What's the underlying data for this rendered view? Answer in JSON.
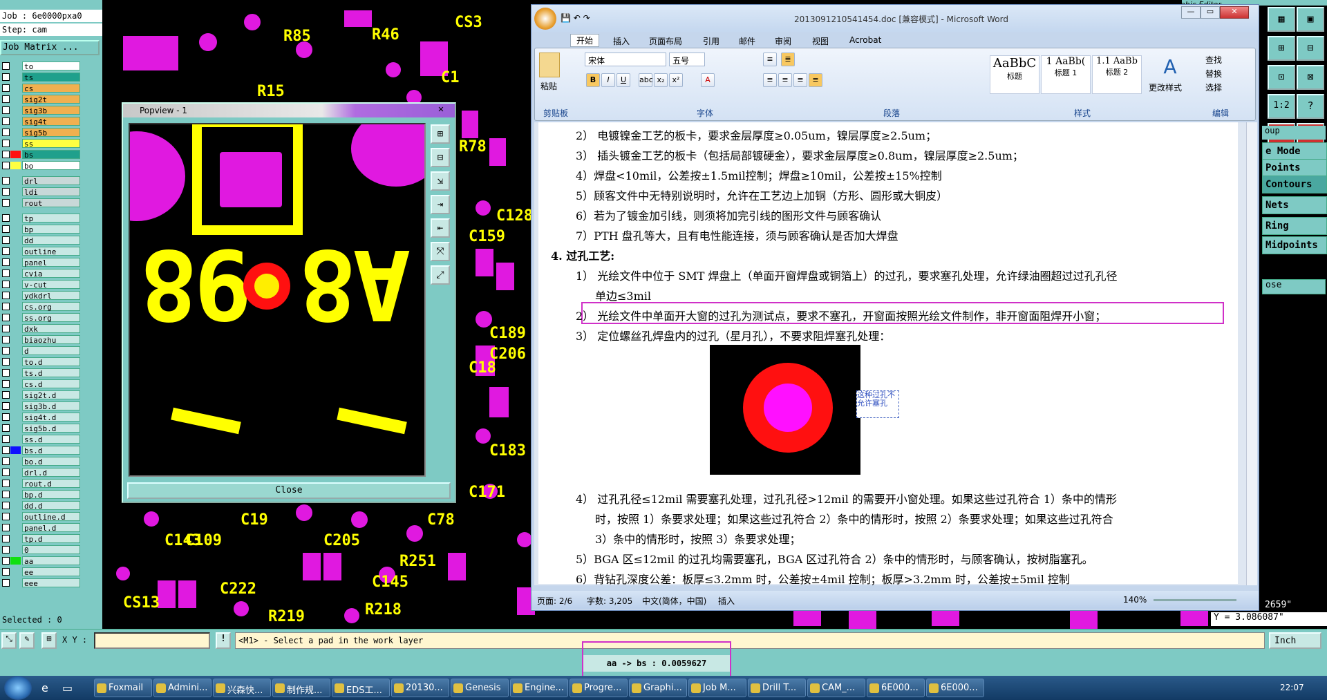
{
  "genesis": {
    "job_label": "Job : 6e0000pxa0",
    "step_label": "Step: cam",
    "job_matrix": "Job Matrix ...",
    "selected": "Selected : 0",
    "layers": [
      {
        "name": "to",
        "swatch": "",
        "bg": "#ffffff"
      },
      {
        "name": "ts",
        "swatch": "",
        "bg": "#1fa08c"
      },
      {
        "name": "cs",
        "swatch": "",
        "bg": "#f0b050"
      },
      {
        "name": "sig2t",
        "swatch": "",
        "bg": "#f0b050"
      },
      {
        "name": "sig3b",
        "swatch": "",
        "bg": "#f0b050"
      },
      {
        "name": "sig4t",
        "swatch": "",
        "bg": "#f0b050"
      },
      {
        "name": "sig5b",
        "swatch": "",
        "bg": "#f0b050"
      },
      {
        "name": "ss",
        "swatch": "",
        "bg": "#ffff40"
      },
      {
        "name": "bs",
        "swatch": "#ff1010",
        "bg": "#1fa08c"
      },
      {
        "name": "bo",
        "swatch": "#ffff40",
        "bg": "#ffffff"
      },
      {
        "name": "drl",
        "swatch": "",
        "bg": "#c8d8d8"
      },
      {
        "name": "ldi",
        "swatch": "",
        "bg": "#c8d8d8"
      },
      {
        "name": "rout",
        "swatch": "",
        "bg": "#c8d8d8"
      },
      {
        "name": "tp",
        "swatch": "",
        "bg": "#c8e8e4"
      },
      {
        "name": "bp",
        "swatch": "",
        "bg": "#c8e8e4"
      },
      {
        "name": "dd",
        "swatch": "",
        "bg": "#c8e8e4"
      },
      {
        "name": "outline",
        "swatch": "",
        "bg": "#c8e8e4"
      },
      {
        "name": "panel",
        "swatch": "",
        "bg": "#c8e8e4"
      },
      {
        "name": "cvia",
        "swatch": "",
        "bg": "#c8e8e4"
      },
      {
        "name": "v-cut",
        "swatch": "",
        "bg": "#c8e8e4"
      },
      {
        "name": "ydkdrl",
        "swatch": "",
        "bg": "#c8e8e4"
      },
      {
        "name": "cs.org",
        "swatch": "",
        "bg": "#c8e8e4"
      },
      {
        "name": "ss.org",
        "swatch": "",
        "bg": "#c8e8e4"
      },
      {
        "name": "dxk",
        "swatch": "",
        "bg": "#c8e8e4"
      },
      {
        "name": "biaozhu",
        "swatch": "",
        "bg": "#c8e8e4"
      },
      {
        "name": "d",
        "swatch": "",
        "bg": "#c8e8e4"
      },
      {
        "name": "to.d",
        "swatch": "",
        "bg": "#c8e8e4"
      },
      {
        "name": "ts.d",
        "swatch": "",
        "bg": "#c8e8e4"
      },
      {
        "name": "cs.d",
        "swatch": "",
        "bg": "#c8e8e4"
      },
      {
        "name": "sig2t.d",
        "swatch": "",
        "bg": "#c8e8e4"
      },
      {
        "name": "sig3b.d",
        "swatch": "",
        "bg": "#c8e8e4"
      },
      {
        "name": "sig4t.d",
        "swatch": "",
        "bg": "#c8e8e4"
      },
      {
        "name": "sig5b.d",
        "swatch": "",
        "bg": "#c8e8e4"
      },
      {
        "name": "ss.d",
        "swatch": "",
        "bg": "#c8e8e4"
      },
      {
        "name": "bs.d",
        "swatch": "#1010ff",
        "bg": "#c8e8e4"
      },
      {
        "name": "bo.d",
        "swatch": "",
        "bg": "#c8e8e4"
      },
      {
        "name": "drl.d",
        "swatch": "",
        "bg": "#c8e8e4"
      },
      {
        "name": "rout.d",
        "swatch": "",
        "bg": "#c8e8e4"
      },
      {
        "name": "bp.d",
        "swatch": "",
        "bg": "#c8e8e4"
      },
      {
        "name": "dd.d",
        "swatch": "",
        "bg": "#c8e8e4"
      },
      {
        "name": "outline.d",
        "swatch": "",
        "bg": "#c8e8e4"
      },
      {
        "name": "panel.d",
        "swatch": "",
        "bg": "#c8e8e4"
      },
      {
        "name": "tp.d",
        "swatch": "",
        "bg": "#c8e8e4"
      },
      {
        "name": "0",
        "swatch": "",
        "bg": "#c8e8e4"
      },
      {
        "name": "aa",
        "swatch": "#10e010",
        "bg": "#c8e8e4"
      },
      {
        "name": "ee",
        "swatch": "",
        "bg": "#c8e8e4"
      },
      {
        "name": "eee",
        "swatch": "",
        "bg": "#c8e8e4"
      }
    ],
    "board_labels": [
      "R85",
      "R46",
      "CS3",
      "C1",
      "R15",
      "R78",
      "R218",
      "C222",
      "C19",
      "C143",
      "C109",
      "C78",
      "C205",
      "R251",
      "C171",
      "C183",
      "CS13",
      "C145",
      "C189",
      "C206",
      "C18",
      "C128",
      "C159",
      "R219"
    ],
    "xy_label": "X Y :",
    "prompt": "<M1> - Select a pad in the work layer",
    "measure": "aa -> bs : 0.0059627",
    "units": "Inch",
    "coord_x_partial": "2659\"",
    "coord_y": "Y = 3.086087\"",
    "graphic_editor_title": "Graphic Editor",
    "right_menu": [
      "e Mode",
      "Points",
      "Contours",
      "Nets",
      "Ring",
      "Midpoints"
    ],
    "close_partial": "ose",
    "group_partial": "oup"
  },
  "popview": {
    "title": "Popview - 1",
    "close": "Close",
    "pad_text_left": "98",
    "pad_text_right": "A8"
  },
  "word": {
    "title": "2013091210541454.doc [兼容模式] - Microsoft Word",
    "tabs": [
      "开始",
      "插入",
      "页面布局",
      "引用",
      "邮件",
      "审阅",
      "视图",
      "Acrobat"
    ],
    "font_name": "宋体",
    "font_size": "五号",
    "paste": "粘贴",
    "groups": [
      "剪贴板",
      "字体",
      "段落",
      "样式",
      "编辑"
    ],
    "styles": [
      {
        "preview": "AaBbC",
        "label": "标题"
      },
      {
        "preview": "1 AaBb(",
        "label": "标题 1"
      },
      {
        "preview": "1.1 AaBb",
        "label": "标题 2"
      }
    ],
    "change_styles": "更改样式",
    "edit_items": [
      "查找",
      "替换",
      "选择"
    ],
    "lines": [
      "2） 电镀镍金工艺的板卡，要求金层厚度≥0.05um，镍层厚度≥2.5um；",
      "3） 插头镀金工艺的板卡（包括局部镀硬金），要求金层厚度≥0.8um，镍层厚度≥2.5um；",
      "4）焊盘<10mil，公差按±1.5mil控制；焊盘≥10mil，公差按±15%控制",
      "5）顾客文件中无特别说明时，允许在工艺边上加铜（方形、圆形或大铜皮）",
      "6）若为了镀金加引线，则须将加完引线的图形文件与顾客确认",
      "7）PTH 盘孔等大，且有电性能连接，须与顾客确认是否加大焊盘",
      "4.   过孔工艺:",
      "1） 光绘文件中位于 SMT 焊盘上（单面开窗焊盘或铜箔上）的过孔，要求塞孔处理，允许绿油圈超过过孔孔径",
      "单边≤3mil",
      "2） 光绘文件中单面开大窗的过孔为测试点，要求不塞孔，开窗面按照光绘文件制作，非开窗面阻焊开小窗；",
      "3） 定位螺丝孔焊盘内的过孔（星月孔），不要求阻焊塞孔处理：",
      "4） 过孔孔径≤12mil 需要塞孔处理，过孔孔径>12mil 的需要开小窗处理。如果这些过孔符合 1）条中的情形",
      "时，按照 1）条要求处理；如果这些过孔符合 2）条中的情形时，按照 2）条要求处理；如果这些过孔符合",
      "3）条中的情形时，按照 3）条要求处理；",
      "5）BGA 区≤12mil 的过孔均需要塞孔，BGA 区过孔符合 2）条中的情形时，与顾客确认，按树脂塞孔。",
      "6）背钻孔深度公差：板厚≤3.2mm 时，公差按±4mil 控制；板厚>3.2mm 时，公差按±5mil 控制"
    ],
    "figure_note": "这种过孔不允许塞孔",
    "status": {
      "page": "页面: 2/6",
      "words": "字数: 3,205",
      "lang": "中文(简体，中国)",
      "mode": "插入",
      "zoom": "140%"
    }
  },
  "taskbar": {
    "items": [
      "Foxmail",
      "Admini...",
      "兴森快...",
      "制作规...",
      "EDS工...",
      "20130...",
      "Genesis",
      "Engine...",
      "Progre...",
      "Graphi...",
      "Job M...",
      "Drill T...",
      "CAM_...",
      "6E000...",
      "6E000..."
    ],
    "clock": "22:07"
  },
  "colors": {
    "pad": "#e019e0",
    "silk": "#ffff00",
    "panel": "#7ecac4",
    "highlight": "#d030c8"
  }
}
